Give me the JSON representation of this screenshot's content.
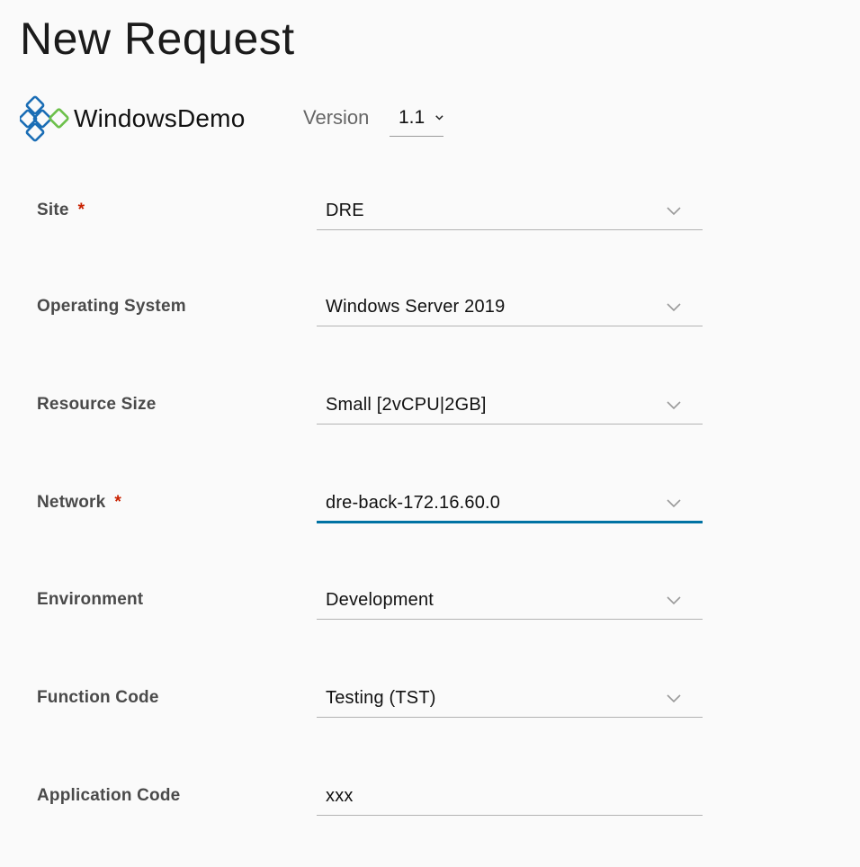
{
  "page": {
    "title": "New Request"
  },
  "brand": {
    "name": "WindowsDemo",
    "logo_icon": "diamond-grid-logo-icon",
    "colors": {
      "blue": "#1a6db5",
      "green": "#6cc04a"
    }
  },
  "version": {
    "label": "Version",
    "value": "1.1"
  },
  "form": {
    "accent_color": "#0072a3",
    "required_color": "#c92100",
    "fields": [
      {
        "label": "Site",
        "required": true,
        "value": "DRE",
        "type": "select"
      },
      {
        "label": "Operating System",
        "required": false,
        "value": "Windows Server 2019",
        "type": "select"
      },
      {
        "label": "Resource Size",
        "required": false,
        "value": "Small [2vCPU|2GB]",
        "type": "select"
      },
      {
        "label": "Network",
        "required": true,
        "value": "dre-back-172.16.60.0",
        "type": "select",
        "focused": true
      },
      {
        "label": "Environment",
        "required": false,
        "value": "Development",
        "type": "select"
      },
      {
        "label": "Function Code",
        "required": false,
        "value": "Testing (TST)",
        "type": "select"
      },
      {
        "label": "Application Code",
        "required": false,
        "value": "xxx",
        "type": "text"
      }
    ],
    "required_marker": "*"
  }
}
